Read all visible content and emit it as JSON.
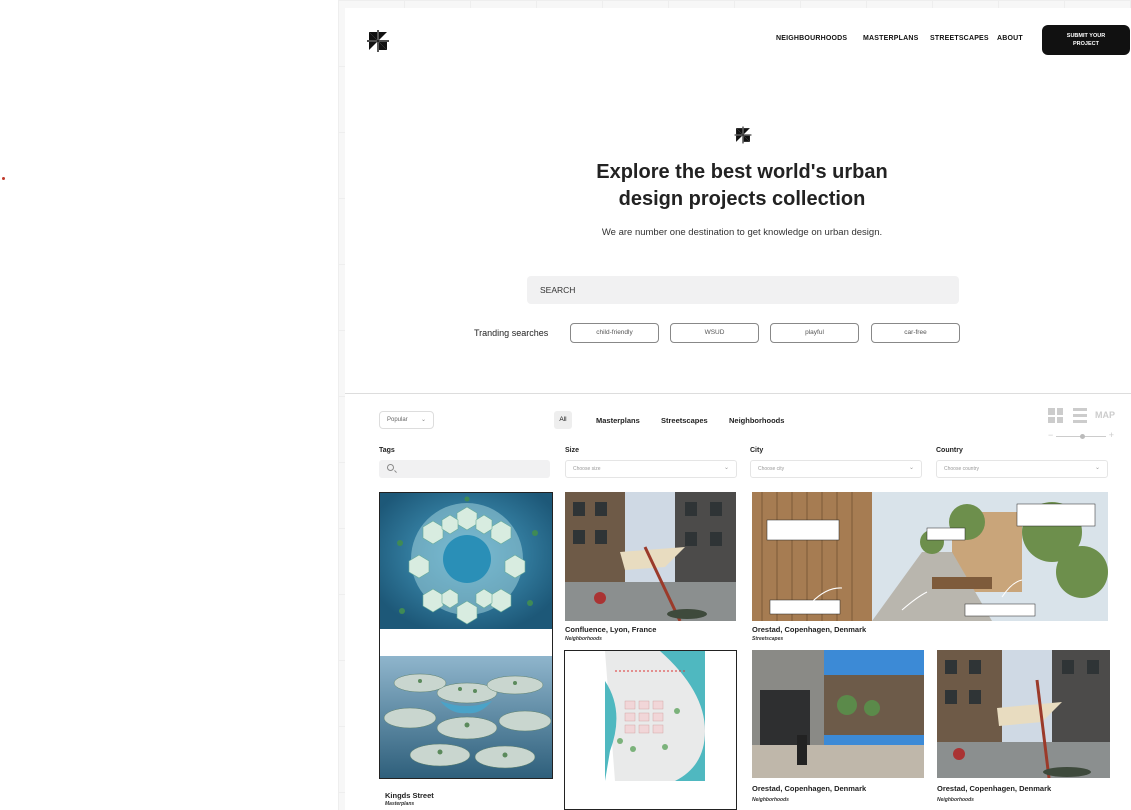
{
  "nav": {
    "items": [
      "NEIGHBOURHOODS",
      "MASTERPLANS",
      "STREETSCAPES",
      "ABOUT"
    ],
    "submit_line1": "SUBMIT YOUR",
    "submit_line2": "PROJECT"
  },
  "hero": {
    "title_line1": "Explore the best world's urban",
    "title_line2": "design projects collection",
    "subtitle": "We are number one destination to get knowledge on urban design.",
    "search_placeholder": "SEARCH",
    "trending_label": "Tranding searches",
    "trending": [
      "child-friendly",
      "WSUD",
      "playful",
      "car-free"
    ]
  },
  "filters": {
    "sort_value": "Popular",
    "tabs": [
      "All",
      "Masterplans",
      "Streetscapes",
      "Neighborhoods"
    ],
    "map_label": "MAP",
    "tags_label": "Tags",
    "size_label": "Size",
    "size_placeholder": "Choose size",
    "city_label": "City",
    "city_placeholder": "Choose city",
    "country_label": "Country",
    "country_placeholder": "Choose country"
  },
  "cards": [
    {
      "title": "Kingds Street",
      "category": "Masterplans"
    },
    {
      "title": "Confluence, Lyon, France",
      "category": "Neighborhoods"
    },
    {
      "title": "Orestad, Copenhagen, Denmark",
      "category": "Streetscapes"
    },
    {
      "title": "Orestad, Copenhagen, Denmark",
      "category": "Neighborhoods"
    },
    {
      "title": "Orestad, Copenhagen, Denmark",
      "category": "Neighborhoods"
    }
  ],
  "colors": {
    "accent": "#111111",
    "chip_border": "#888888",
    "search_bg": "#f1f1f2"
  }
}
